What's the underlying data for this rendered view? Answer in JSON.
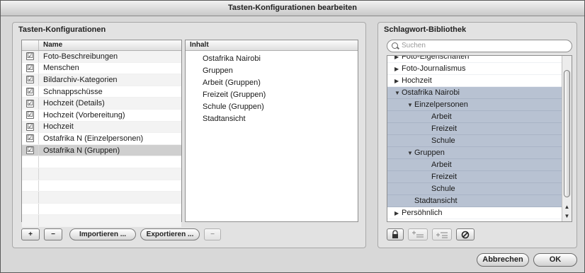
{
  "window": {
    "title": "Tasten-Konfigurationen bearbeiten"
  },
  "left_panel": {
    "title": "Tasten-Konfigurationen",
    "name_header": "Name",
    "rows": [
      {
        "label": "Foto-Beschreibungen",
        "checked": "☑",
        "selected": false
      },
      {
        "label": "Menschen",
        "checked": "☑",
        "selected": false
      },
      {
        "label": "Bildarchiv-Kategorien",
        "checked": "☑",
        "selected": false
      },
      {
        "label": "Schnappschüsse",
        "checked": "☑",
        "selected": false
      },
      {
        "label": "Hochzeit (Details)",
        "checked": "☑",
        "selected": false
      },
      {
        "label": "Hochzeit (Vorbereitung)",
        "checked": "☑",
        "selected": false
      },
      {
        "label": "Hochzeit",
        "checked": "☑",
        "selected": false
      },
      {
        "label": "Ostafrika N (Einzelpersonen)",
        "checked": "☑",
        "selected": false
      },
      {
        "label": "Ostafrika N (Gruppen)",
        "checked": "☑",
        "selected": true
      }
    ],
    "content_header": "Inhalt",
    "content_items": [
      "Ostafrika Nairobi",
      "Gruppen",
      "Arbeit (Gruppen)",
      "Freizeit (Gruppen)",
      "Schule (Gruppen)",
      "Stadtansicht"
    ],
    "buttons": {
      "add": "+",
      "remove": "−",
      "import": "Importieren ...",
      "export": "Exportieren ...",
      "remove_content": "−"
    }
  },
  "right_panel": {
    "title": "Schlagwort-Bibliothek",
    "search_placeholder": "Suchen",
    "tree": [
      {
        "label": "Foto-Eigenschaften",
        "arrow": "▶",
        "indent": 0,
        "highlight": false
      },
      {
        "label": "Foto-Journalismus",
        "arrow": "▶",
        "indent": 0,
        "highlight": false
      },
      {
        "label": "Hochzeit",
        "arrow": "▶",
        "indent": 0,
        "highlight": false
      },
      {
        "label": "Ostafrika Nairobi",
        "arrow": "▼",
        "indent": 0,
        "highlight": true
      },
      {
        "label": "Einzelpersonen",
        "arrow": "▼",
        "indent": 1,
        "highlight": true
      },
      {
        "label": "Arbeit",
        "arrow": "",
        "indent": 2,
        "highlight": true
      },
      {
        "label": "Freizeit",
        "arrow": "",
        "indent": 2,
        "highlight": true
      },
      {
        "label": "Schule",
        "arrow": "",
        "indent": 2,
        "highlight": true
      },
      {
        "label": "Gruppen",
        "arrow": "▼",
        "indent": 1,
        "highlight": true
      },
      {
        "label": "Arbeit",
        "arrow": "",
        "indent": 2,
        "highlight": true
      },
      {
        "label": "Freizeit",
        "arrow": "",
        "indent": 2,
        "highlight": true
      },
      {
        "label": "Schule",
        "arrow": "",
        "indent": 2,
        "highlight": true
      },
      {
        "label": "Stadtansicht",
        "arrow": "",
        "indent": 1,
        "highlight": true
      },
      {
        "label": "Persöhnlich",
        "arrow": "▶",
        "indent": 0,
        "highlight": false
      }
    ],
    "scroll_up": "▲",
    "scroll_down": "▼",
    "toolbar_icons": [
      "lock-icon",
      "add-keyword-icon",
      "add-subkeyword-icon",
      "remove-keyword-icon"
    ]
  },
  "footer": {
    "cancel": "Abbrechen",
    "ok": "OK"
  },
  "colors": {
    "window_bg": "#d8d8d8",
    "highlight": "#b8c2d2",
    "selected_row": "#cfcfcf"
  }
}
